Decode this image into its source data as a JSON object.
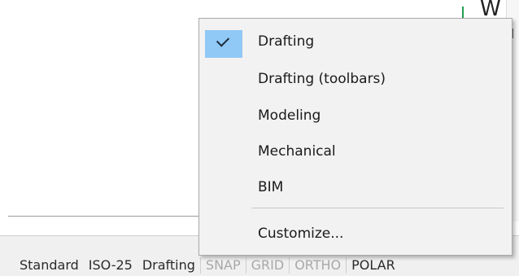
{
  "top_right_text": "W",
  "menu": {
    "items": [
      {
        "label": "Drafting",
        "checked": true
      },
      {
        "label": "Drafting (toolbars)",
        "checked": false
      },
      {
        "label": "Modeling",
        "checked": false
      },
      {
        "label": "Mechanical",
        "checked": false
      },
      {
        "label": "BIM",
        "checked": false
      }
    ],
    "customize_label": "Customize..."
  },
  "statusbar": {
    "items": [
      {
        "label": "Standard",
        "state": "normal"
      },
      {
        "label": "ISO-25",
        "state": "normal"
      },
      {
        "label": "Drafting",
        "state": "normal"
      },
      {
        "label": "SNAP",
        "state": "off"
      },
      {
        "label": "GRID",
        "state": "off"
      },
      {
        "label": "ORTHO",
        "state": "off"
      },
      {
        "label": "POLAR",
        "state": "on"
      }
    ]
  },
  "colors": {
    "check_highlight": "#90c8f6",
    "menu_background": "#f2f2f2",
    "status_off_text": "#a8a8a8",
    "grid_line_green": "#1f9e4f"
  }
}
